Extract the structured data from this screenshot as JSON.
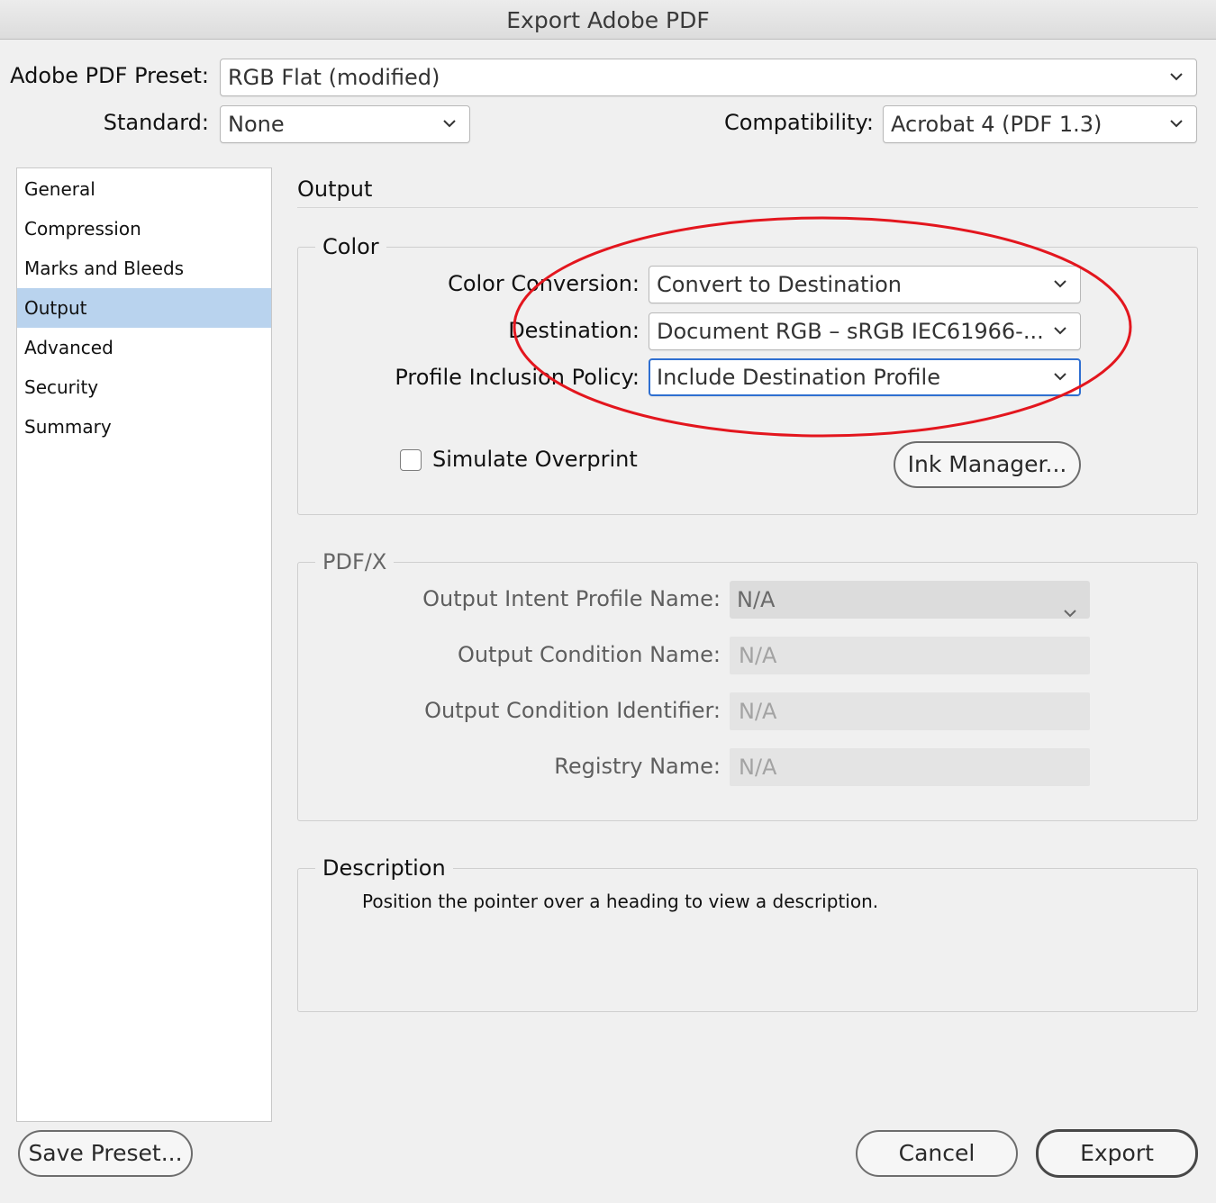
{
  "window": {
    "title": "Export Adobe PDF"
  },
  "top": {
    "preset_label": "Adobe PDF Preset:",
    "preset_value": "RGB Flat (modified)",
    "standard_label": "Standard:",
    "standard_value": "None",
    "compat_label": "Compatibility:",
    "compat_value": "Acrobat 4 (PDF 1.3)"
  },
  "sidebar": {
    "items": [
      {
        "label": "General"
      },
      {
        "label": "Compression"
      },
      {
        "label": "Marks and Bleeds"
      },
      {
        "label": "Output"
      },
      {
        "label": "Advanced"
      },
      {
        "label": "Security"
      },
      {
        "label": "Summary"
      }
    ],
    "selected": "Output"
  },
  "main": {
    "title": "Output",
    "color": {
      "legend": "Color",
      "conversion_label": "Color Conversion:",
      "conversion_value": "Convert to Destination",
      "destination_label": "Destination:",
      "destination_value": "Document RGB – sRGB IEC61966-...",
      "policy_label": "Profile Inclusion Policy:",
      "policy_value": "Include Destination Profile",
      "simulate_overprint_label": "Simulate Overprint",
      "simulate_overprint_checked": false,
      "ink_manager_label": "Ink Manager..."
    },
    "pdfx": {
      "legend": "PDF/X",
      "intent_label": "Output Intent Profile Name:",
      "intent_value": "N/A",
      "condition_name_label": "Output Condition Name:",
      "condition_name_value": "N/A",
      "condition_id_label": "Output Condition Identifier:",
      "condition_id_value": "N/A",
      "registry_label": "Registry Name:",
      "registry_value": "N/A"
    },
    "description": {
      "legend": "Description",
      "text": "Position the pointer over a heading to view a description."
    }
  },
  "footer": {
    "save_preset_label": "Save Preset...",
    "cancel_label": "Cancel",
    "export_label": "Export"
  },
  "annotation": {
    "color": "#e3161e",
    "shape": "ellipse"
  }
}
